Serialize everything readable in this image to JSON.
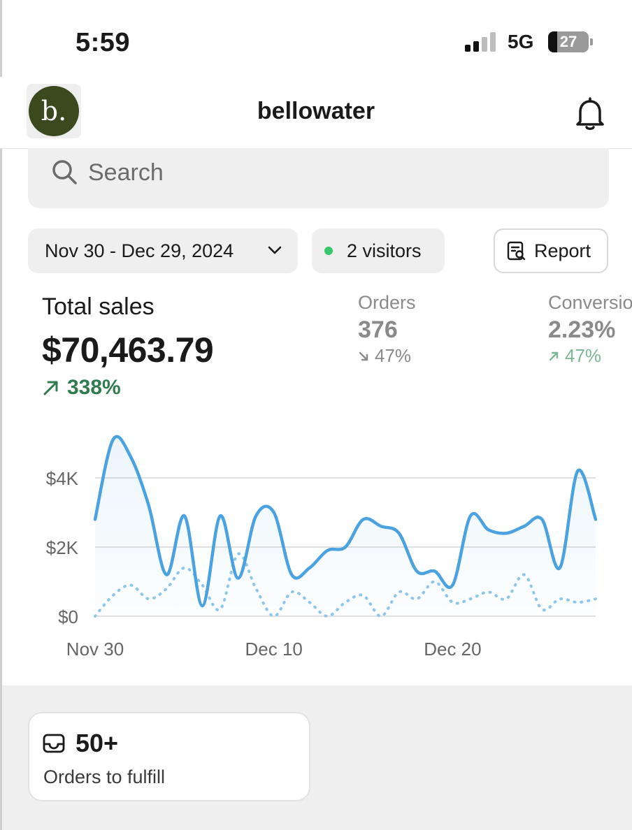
{
  "status_bar": {
    "time": "5:59",
    "network": "5G",
    "battery": "27"
  },
  "header": {
    "logo_text": "b.",
    "store_name": "bellowater",
    "bell_icon": "bell-icon"
  },
  "search": {
    "placeholder": "Search"
  },
  "filters": {
    "date_range": "Nov 30 - Dec 29, 2024",
    "visitors": "2 visitors",
    "report_label": "Report"
  },
  "metrics": {
    "total_sales": {
      "label": "Total sales",
      "value": "$70,463.79",
      "change": "338%",
      "direction": "up"
    },
    "orders": {
      "label": "Orders",
      "value": "376",
      "change": "47%",
      "direction": "down"
    },
    "conversion": {
      "label": "Conversion",
      "value": "2.23%",
      "change": "47%",
      "direction": "up"
    }
  },
  "chart_data": {
    "type": "line",
    "ylim": [
      0,
      5000
    ],
    "y_ticks": [
      "$0",
      "$2K",
      "$4K"
    ],
    "y_tick_values": [
      0,
      2000,
      4000
    ],
    "x_tick_labels": [
      "Nov 30",
      "Dec 10",
      "Dec 20"
    ],
    "x_tick_indices": [
      0,
      10,
      20
    ],
    "grid": true,
    "series": [
      {
        "style": "solid",
        "values": [
          2800,
          5100,
          4600,
          3200,
          1200,
          2900,
          300,
          2900,
          1100,
          2900,
          3000,
          1200,
          1400,
          1900,
          2000,
          2800,
          2600,
          2400,
          1300,
          1300,
          900,
          2900,
          2500,
          2400,
          2600,
          2800,
          1400,
          4200,
          2800
        ]
      },
      {
        "style": "dotted",
        "values": [
          0,
          600,
          900,
          500,
          800,
          1400,
          900,
          200,
          1800,
          800,
          0,
          700,
          400,
          0,
          400,
          600,
          0,
          700,
          500,
          1000,
          400,
          500,
          700,
          500,
          1200,
          200,
          500,
          400,
          500
        ]
      }
    ],
    "colors": {
      "line": "#4aa3e0",
      "grid": "#e0e0e0",
      "label": "#666666"
    }
  },
  "fulfill_card": {
    "value": "50+",
    "label": "Orders to fulfill"
  }
}
